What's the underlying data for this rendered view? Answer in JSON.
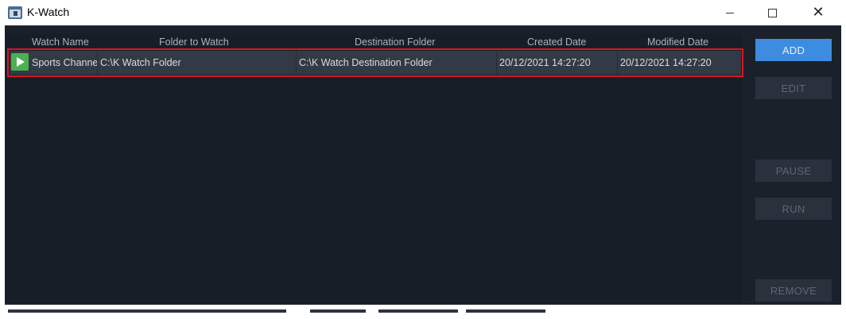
{
  "window": {
    "title": "K-Watch",
    "close_glyph": "✕"
  },
  "table": {
    "columns": [
      "Watch Name",
      "Folder to Watch",
      "Destination Folder",
      "Created Date",
      "Modified Date"
    ],
    "rows": [
      {
        "status_icon": "play-icon",
        "watch_name": "Sports Channe",
        "folder_to_watch": "C:\\K Watch Folder",
        "destination_folder": "C:\\K Watch Destination Folder",
        "created_date": "20/12/2021 14:27:20",
        "modified_date": "20/12/2021 14:27:20"
      }
    ]
  },
  "buttons": {
    "add": "ADD",
    "edit": "EDIT",
    "pause": "PAUSE",
    "run": "RUN",
    "remove": "REMOVE"
  },
  "colors": {
    "window_bg": "#1b212b",
    "row_bg": "#323a45",
    "selection_outline": "#e0141c",
    "add_button": "#3d8ce0",
    "play_green": "#4caf50"
  }
}
